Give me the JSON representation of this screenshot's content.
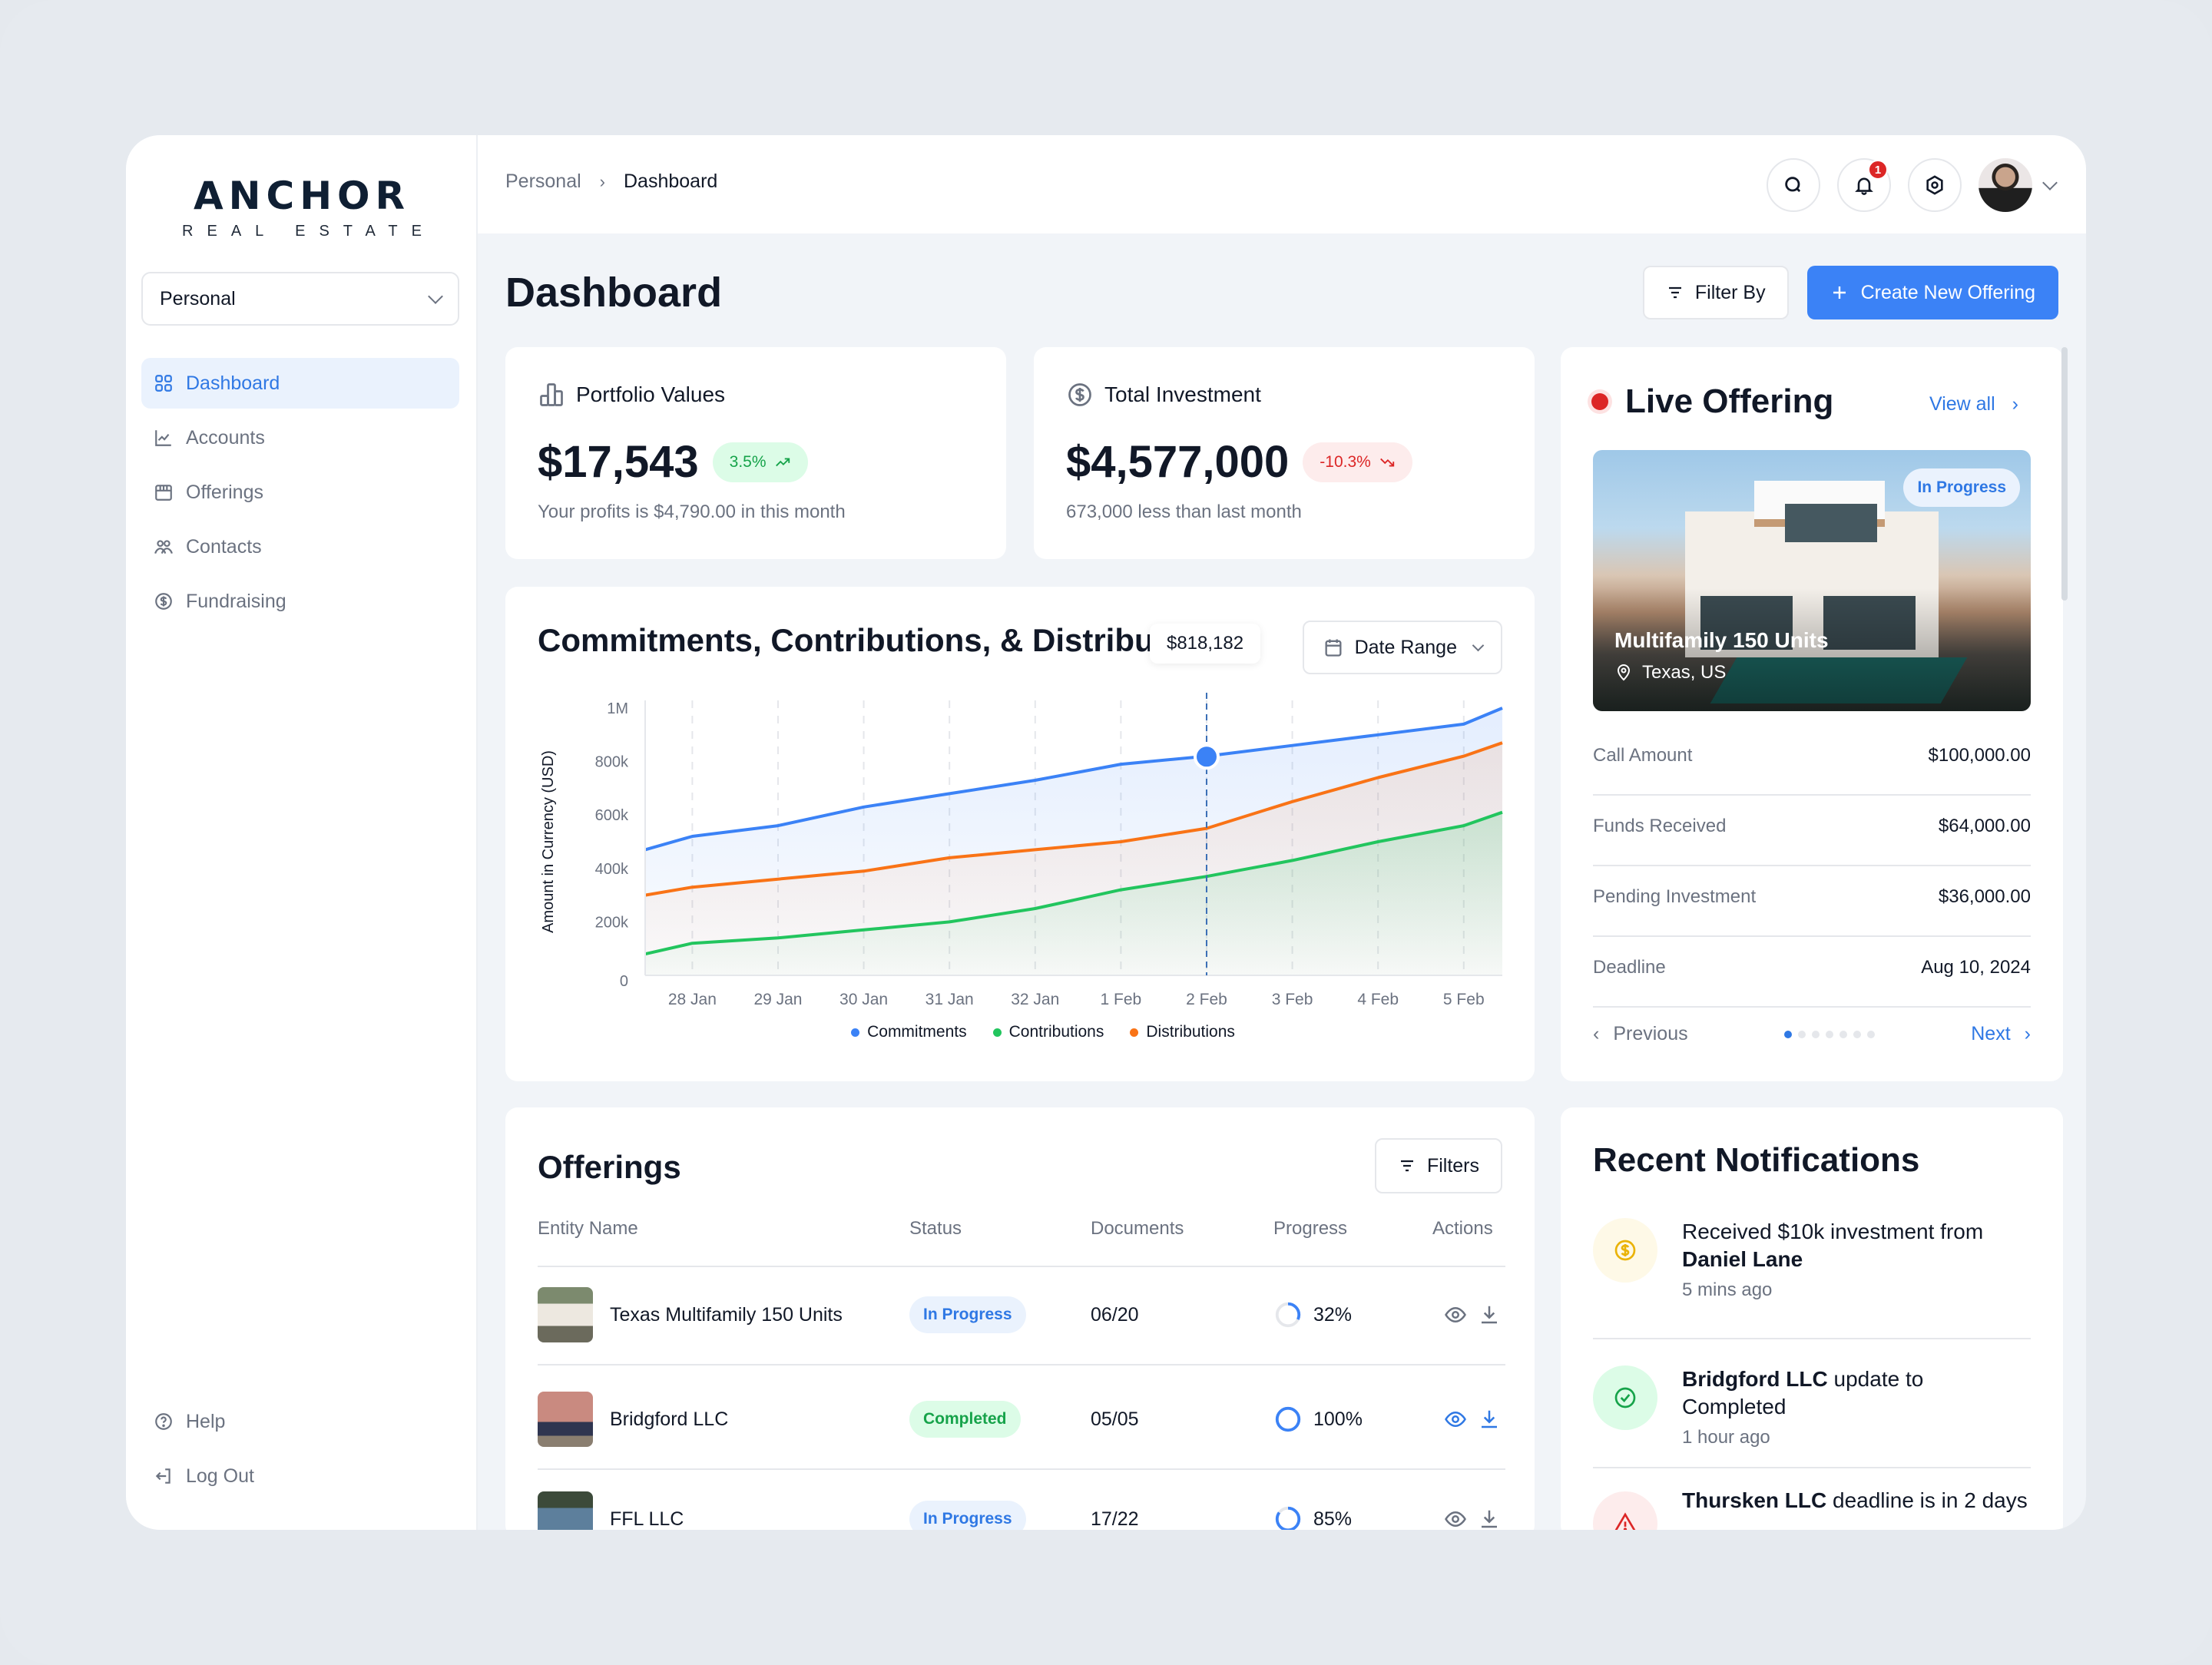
{
  "brand": {
    "name": "ANCHOR",
    "tagline": "REAL ESTATE"
  },
  "workspace_select": {
    "value": "Personal"
  },
  "sidebar": {
    "items": [
      {
        "label": "Dashboard",
        "icon": "grid-icon",
        "active": true
      },
      {
        "label": "Accounts",
        "icon": "chart-line-icon",
        "active": false
      },
      {
        "label": "Offerings",
        "icon": "storefront-icon",
        "active": false
      },
      {
        "label": "Contacts",
        "icon": "users-icon",
        "active": false
      },
      {
        "label": "Fundraising",
        "icon": "dollar-circle-icon",
        "active": false
      }
    ],
    "bottom": [
      {
        "label": "Help",
        "icon": "help-circle-icon"
      },
      {
        "label": "Log Out",
        "icon": "logout-icon"
      }
    ]
  },
  "topbar": {
    "breadcrumb": [
      "Personal",
      "Dashboard"
    ],
    "notification_count": "1"
  },
  "page": {
    "title": "Dashboard",
    "filter_label": "Filter By",
    "create_label": "Create New Offering"
  },
  "stats": [
    {
      "title": "Portfolio Values",
      "value": "$17,543",
      "change": "3.5%",
      "trend": "up",
      "sub": "Your profits is $4,790.00 in this month"
    },
    {
      "title": "Total Investment",
      "value": "$4,577,000",
      "change": "-10.3%",
      "trend": "down",
      "sub": "673,000 less than last month"
    }
  ],
  "chart_card": {
    "title": "Commitments, Contributions, & Distributions",
    "date_range_label": "Date Range",
    "tooltip": "$818,182"
  },
  "chart_data": {
    "type": "area",
    "title": "Commitments, Contributions, & Distributions",
    "xlabel": "",
    "ylabel": "Amount in Currency (USD)",
    "ylim": [
      0,
      1000000
    ],
    "y_ticks": [
      "0",
      "200k",
      "400k",
      "600k",
      "800k",
      "1M"
    ],
    "categories": [
      "28 Jan",
      "29 Jan",
      "30 Jan",
      "31 Jan",
      "32 Jan",
      "1 Feb",
      "2 Feb",
      "3 Feb",
      "4 Feb",
      "5 Feb"
    ],
    "x": [
      -0.55,
      0,
      1,
      2,
      3,
      4,
      5,
      6,
      7,
      8,
      9,
      9.45
    ],
    "series": [
      {
        "name": "Commitments",
        "color": "#3b82f6",
        "values": [
          470000,
          520000,
          560000,
          630000,
          680000,
          730000,
          790000,
          820000,
          860000,
          900000,
          940000,
          1000000
        ]
      },
      {
        "name": "Contributions",
        "color": "#22c55e",
        "values": [
          80000,
          120000,
          140000,
          170000,
          200000,
          250000,
          320000,
          370000,
          430000,
          500000,
          560000,
          610000
        ]
      },
      {
        "name": "Distributions",
        "color": "#f97316",
        "values": [
          300000,
          330000,
          360000,
          390000,
          440000,
          470000,
          500000,
          550000,
          650000,
          740000,
          820000,
          870000
        ]
      }
    ],
    "highlight": {
      "category": "2 Feb",
      "series": "Commitments",
      "value": 818182,
      "label": "$818,182"
    },
    "grid": true,
    "legend": "bottom-center"
  },
  "live_offering": {
    "title": "Live Offering",
    "view_all": "View all",
    "status": "In Progress",
    "name": "Multifamily 150 Units",
    "location": "Texas, US",
    "details": [
      {
        "label": "Call Amount",
        "value": "$100,000.00"
      },
      {
        "label": "Funds Received",
        "value": "$64,000.00"
      },
      {
        "label": "Pending Investment",
        "value": "$36,000.00"
      },
      {
        "label": "Deadline",
        "value": "Aug 10, 2024"
      }
    ],
    "prev_label": "Previous",
    "next_label": "Next",
    "page_count": 7,
    "current_page": 1
  },
  "offerings": {
    "title": "Offerings",
    "filters_label": "Filters",
    "columns": [
      "Entity Name",
      "Status",
      "Documents",
      "Progress",
      "Actions"
    ],
    "rows": [
      {
        "name": "Texas Multifamily 150 Units",
        "status": "In Progress",
        "documents": "06/20",
        "progress": "32%",
        "progress_value": 0.32
      },
      {
        "name": "Bridgford LLC",
        "status": "Completed",
        "documents": "05/05",
        "progress": "100%",
        "progress_value": 1.0
      },
      {
        "name": "FFL LLC",
        "status": "In Progress",
        "documents": "17/22",
        "progress": "85%",
        "progress_value": 0.85
      }
    ]
  },
  "notifications": {
    "title": "Recent Notifications",
    "items": [
      {
        "pre": "Received $10k investment from ",
        "bold": "Daniel Lane",
        "post": "",
        "time": "5 mins ago",
        "icon": "dollar-icon",
        "color": "#eab308",
        "bg": "#fef9e7"
      },
      {
        "pre": "",
        "bold": "Bridgford LLC",
        "post": " update to Completed",
        "time": "1 hour ago",
        "icon": "check-circle-icon",
        "color": "#16a34a",
        "bg": "#dcfce7"
      },
      {
        "pre": "",
        "bold": "Thursken LLC",
        "post": " deadline is in 2 days",
        "time": "",
        "icon": "warning-icon",
        "color": "#dc2626",
        "bg": "#fdecec"
      }
    ]
  }
}
